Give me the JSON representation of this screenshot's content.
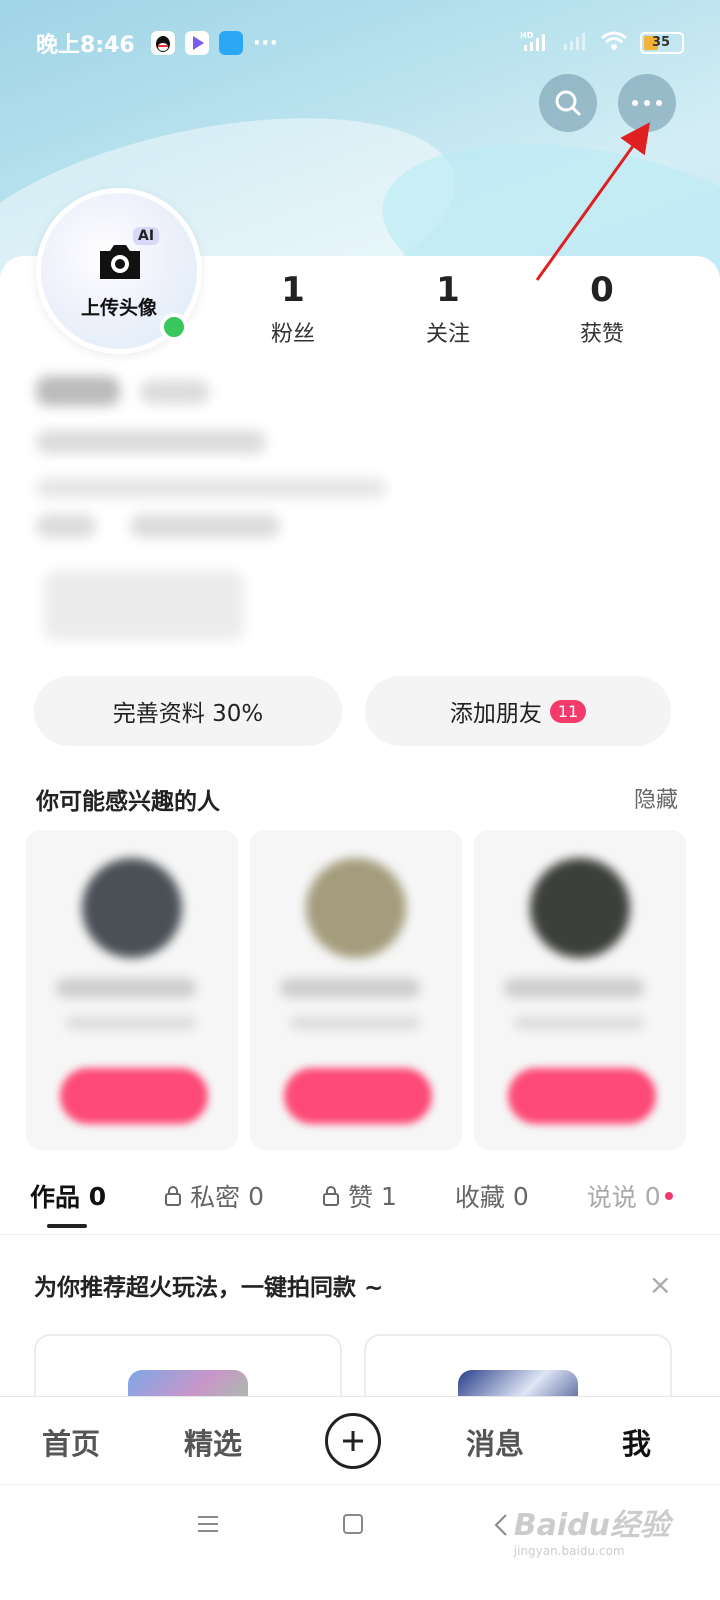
{
  "status_bar": {
    "time": "晚上8:46",
    "more": "···",
    "network": "HD",
    "battery": "35"
  },
  "header_actions": {
    "search_icon": "search-icon",
    "more_icon": "more-dots-icon"
  },
  "profile": {
    "avatar_ai_badge": "AI",
    "avatar_upload_label": "上传头像",
    "stats": [
      {
        "value": "1",
        "label": "粉丝"
      },
      {
        "value": "1",
        "label": "关注"
      },
      {
        "value": "0",
        "label": "获赞"
      }
    ]
  },
  "actions": {
    "complete_profile": "完善资料 30%",
    "add_friend": "添加朋友",
    "add_friend_badge": "11"
  },
  "suggestions": {
    "title": "你可能感兴趣的人",
    "hide": "隐藏"
  },
  "tabs": [
    {
      "label": "作品",
      "count": "0"
    },
    {
      "label": "私密",
      "count": "0"
    },
    {
      "label": "赞",
      "count": "1"
    },
    {
      "label": "收藏",
      "count": "0"
    },
    {
      "label": "说说",
      "count": "0"
    }
  ],
  "recommend": {
    "title": "为你推荐超火玩法，一键拍同款 ~",
    "close": "×"
  },
  "bottom_nav": {
    "home": "首页",
    "featured": "精选",
    "messages": "消息",
    "me": "我"
  },
  "watermark": {
    "brand": "Baidu经验",
    "url": "jingyan.baidu.com"
  },
  "colors": {
    "accent_pink": "#f43a6a",
    "online_green": "#38c75a",
    "annotation_arrow": "#e02020"
  }
}
